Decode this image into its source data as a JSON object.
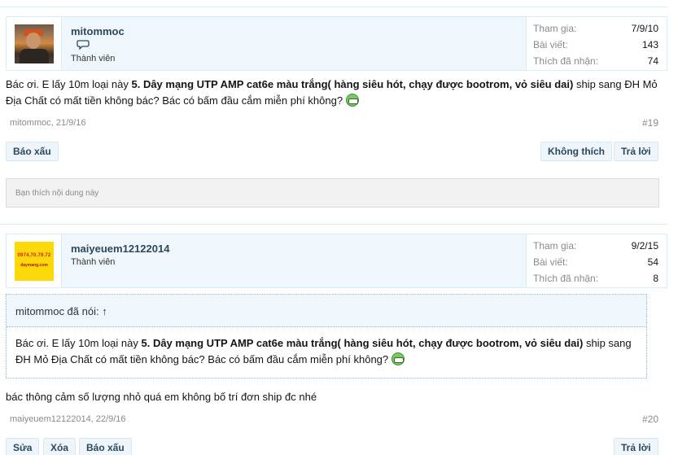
{
  "posts": [
    {
      "username": "mitommoc",
      "user_title": "Thành viên",
      "avatar": "user-photo-avatar",
      "stats": [
        {
          "label": "Tham gia:",
          "value": "7/9/10"
        },
        {
          "label": "Bài viết:",
          "value": "143"
        },
        {
          "label": "Thích đã nhận:",
          "value": "74"
        }
      ],
      "message_plain_1": "Bác ơi. E lấy 10m loại này ",
      "message_bold": "5. Dây mạng UTP AMP cat6e màu trắng( hàng siêu hót, chạy được bootrom, vỏ siêu dai)",
      "message_plain_2": " ship sang ĐH Mỏ Địa Chất có mất tiền không bác? Bác có bấm đầu cắm miễn phí không?",
      "author_date": "mitommoc, 21/9/16",
      "post_number": "#19",
      "report_label": "Báo xấu",
      "unlike_label": "Không thích",
      "reply_label": "Trả lời",
      "likes_summary": "Bạn thích nội dung này"
    },
    {
      "username": "maiyeuem12122014",
      "user_title": "Thành viên",
      "avatar": "shop-logo-avatar",
      "avatar_phone": "0974.70.79.72",
      "avatar_site": "daymang.com",
      "stats": [
        {
          "label": "Tham gia:",
          "value": "9/2/15"
        },
        {
          "label": "Bài viết:",
          "value": "54"
        },
        {
          "label": "Thích đã nhận:",
          "value": "8"
        }
      ],
      "quote_header": "mitommoc đã nói: ↑",
      "quote_plain_1": "Bác ơi. E lấy 10m loại này ",
      "quote_bold": "5. Dây mạng UTP AMP cat6e màu trắng( hàng siêu hót, chạy được bootrom, vỏ siêu dai)",
      "quote_plain_2": " ship sang ĐH Mỏ Địa Chất có mất tiền không bác? Bác có bấm đầu cắm miễn phí không?",
      "message": "bác thông cảm số lượng nhỏ quá em không bố trí đơn ship đc nhé",
      "author_date": "maiyeuem12122014, 22/9/16",
      "post_number": "#20",
      "edit_label": "Sửa",
      "delete_label": "Xóa",
      "report_label": "Báo xấu",
      "reply_label": "Trả lời"
    }
  ],
  "colors": {
    "accent_blue": "#2b485c",
    "userbar_bg": "#f0f7fc",
    "border": "#d7edfc"
  }
}
